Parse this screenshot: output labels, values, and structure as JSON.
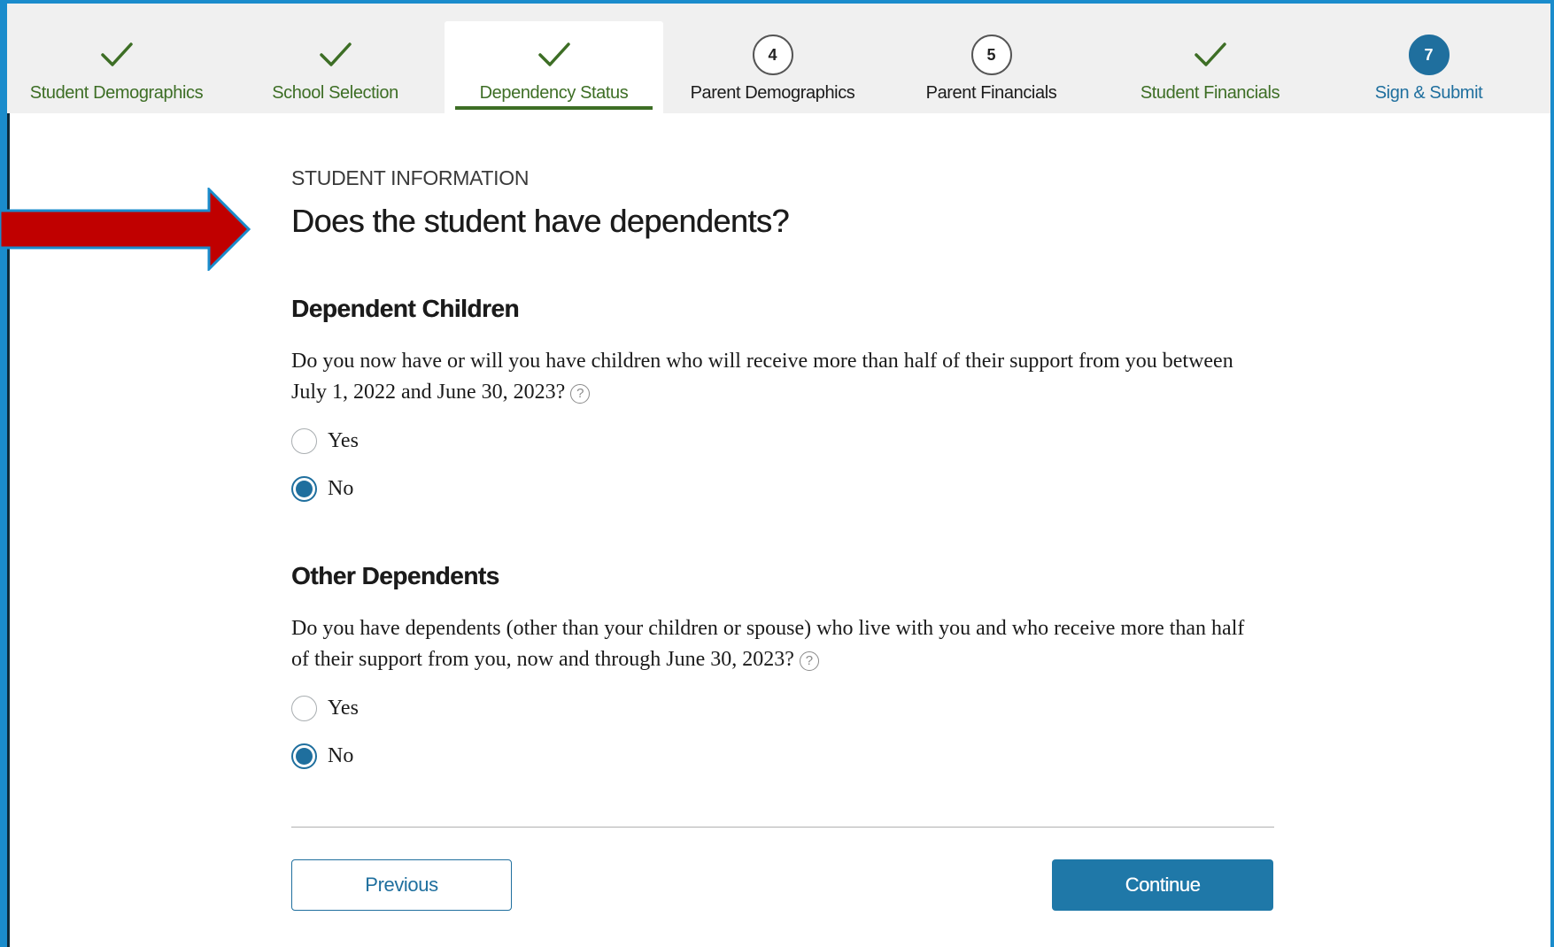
{
  "stepper": {
    "steps": [
      {
        "label": "Student Demographics",
        "status": "done",
        "marker": ""
      },
      {
        "label": "School Selection",
        "status": "done",
        "marker": ""
      },
      {
        "label": "Dependency Status",
        "status": "done",
        "marker": "",
        "active": true
      },
      {
        "label": "Parent Demographics",
        "status": "todo",
        "marker": "4"
      },
      {
        "label": "Parent Financials",
        "status": "todo",
        "marker": "5"
      },
      {
        "label": "Student Financials",
        "status": "done",
        "marker": ""
      },
      {
        "label": "Sign & Submit",
        "status": "current",
        "marker": "7"
      }
    ],
    "colors": {
      "done": "#3d6e25",
      "current": "#1f6f9e",
      "todo": "#1b1b1b"
    }
  },
  "main": {
    "eyebrow": "STUDENT INFORMATION",
    "title": "Does the student have dependents?",
    "sections": [
      {
        "title": "Dependent Children",
        "question": "Do you now have or will you have children who will receive more than half of their support from you between July 1, 2022 and June 30, 2023?",
        "options": [
          {
            "label": "Yes",
            "checked": false
          },
          {
            "label": "No",
            "checked": true
          }
        ]
      },
      {
        "title": "Other Dependents",
        "question": "Do you have dependents (other than your children or spouse) who live with you and who receive more than half of their support from you, now and through June 30, 2023?",
        "options": [
          {
            "label": "Yes",
            "checked": false
          },
          {
            "label": "No",
            "checked": true
          }
        ]
      }
    ],
    "help_icon": "?"
  },
  "buttons": {
    "previous": "Previous",
    "continue": "Continue"
  },
  "annotation": {
    "arrow_color": "#c00000",
    "arrow_outline": "#1a8ccc"
  }
}
